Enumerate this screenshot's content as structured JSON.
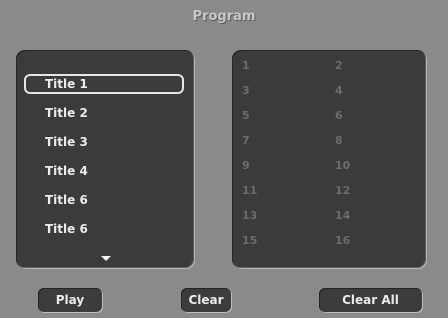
{
  "header": {
    "title": "Program"
  },
  "titles": [
    "Title 1",
    "Title 2",
    "Title 3",
    "Title 4",
    "Title 6",
    "Title 6"
  ],
  "selected_index": 0,
  "program_slots": [
    "1",
    "2",
    "3",
    "4",
    "5",
    "6",
    "7",
    "8",
    "9",
    "10",
    "11",
    "12",
    "13",
    "14",
    "15",
    "16"
  ],
  "buttons": {
    "play": "Play",
    "clear": "Clear",
    "clear_all": "Clear All"
  }
}
